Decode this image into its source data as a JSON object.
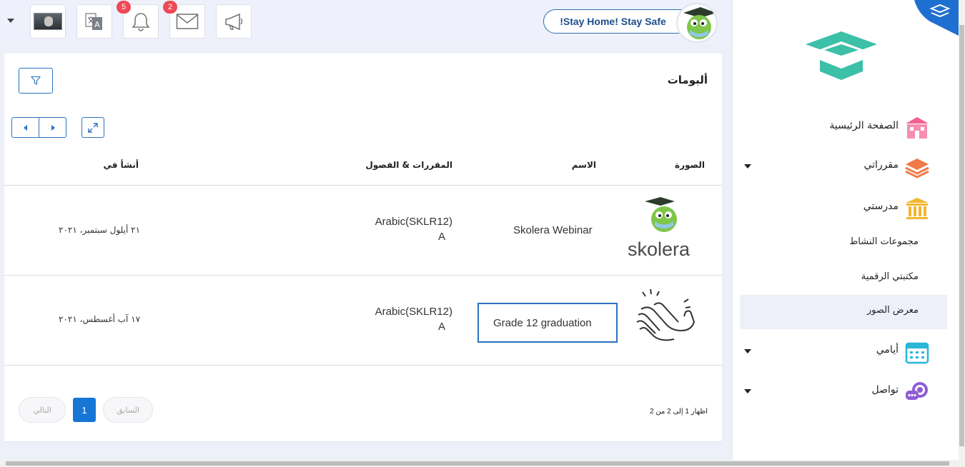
{
  "topbar": {
    "notifications_count": "5",
    "messages_count": "2",
    "stay_home": "!Stay Home! Stay Safe"
  },
  "albums": {
    "title": "ألبومات",
    "columns": {
      "image": "الصورة",
      "name": "الاسم",
      "courses": "المقررات & الفصول",
      "created": "أنشأ في"
    },
    "rows": [
      {
        "image_text": "skolera",
        "name": "Skolera Webinar",
        "course_line1": "Arabic(SKLR12)",
        "course_line2": "A",
        "created": "٢١ أيلول سبتمبر، ٢٠٢١"
      },
      {
        "image_text": "",
        "name": "Grade 12 graduation",
        "course_line1": "Arabic(SKLR12)",
        "course_line2": "A",
        "created": "١٧ آب أغسطس، ٢٠٢١"
      }
    ],
    "pagination": {
      "info": "اظهار 1 إلى 2 من 2",
      "previous": "السابق",
      "current": "1",
      "next": "التالي"
    }
  },
  "sidebar": {
    "items": [
      {
        "label": "الصفحة الرئيسية",
        "icon": "home-icon"
      },
      {
        "label": "مقرراتي",
        "icon": "layers-icon"
      },
      {
        "label": "مدرستي",
        "icon": "school-icon"
      },
      {
        "label": "مجموعات النشاط"
      },
      {
        "label": "مكتبتي الرقمية"
      },
      {
        "label": "معرض الصور"
      },
      {
        "label": "أيامي",
        "icon": "calendar-icon"
      },
      {
        "label": "تواصل",
        "icon": "chat-icon"
      }
    ]
  },
  "colors": {
    "accent": "#1676d6",
    "badge": "#ec4a55",
    "home_icon": "#f06292",
    "layers_icon": "#f07a4a",
    "school_icon": "#f2b632",
    "calendar_icon": "#29b6d8",
    "chat_icon": "#8e5bd6",
    "logo": "#3cc0a8"
  }
}
